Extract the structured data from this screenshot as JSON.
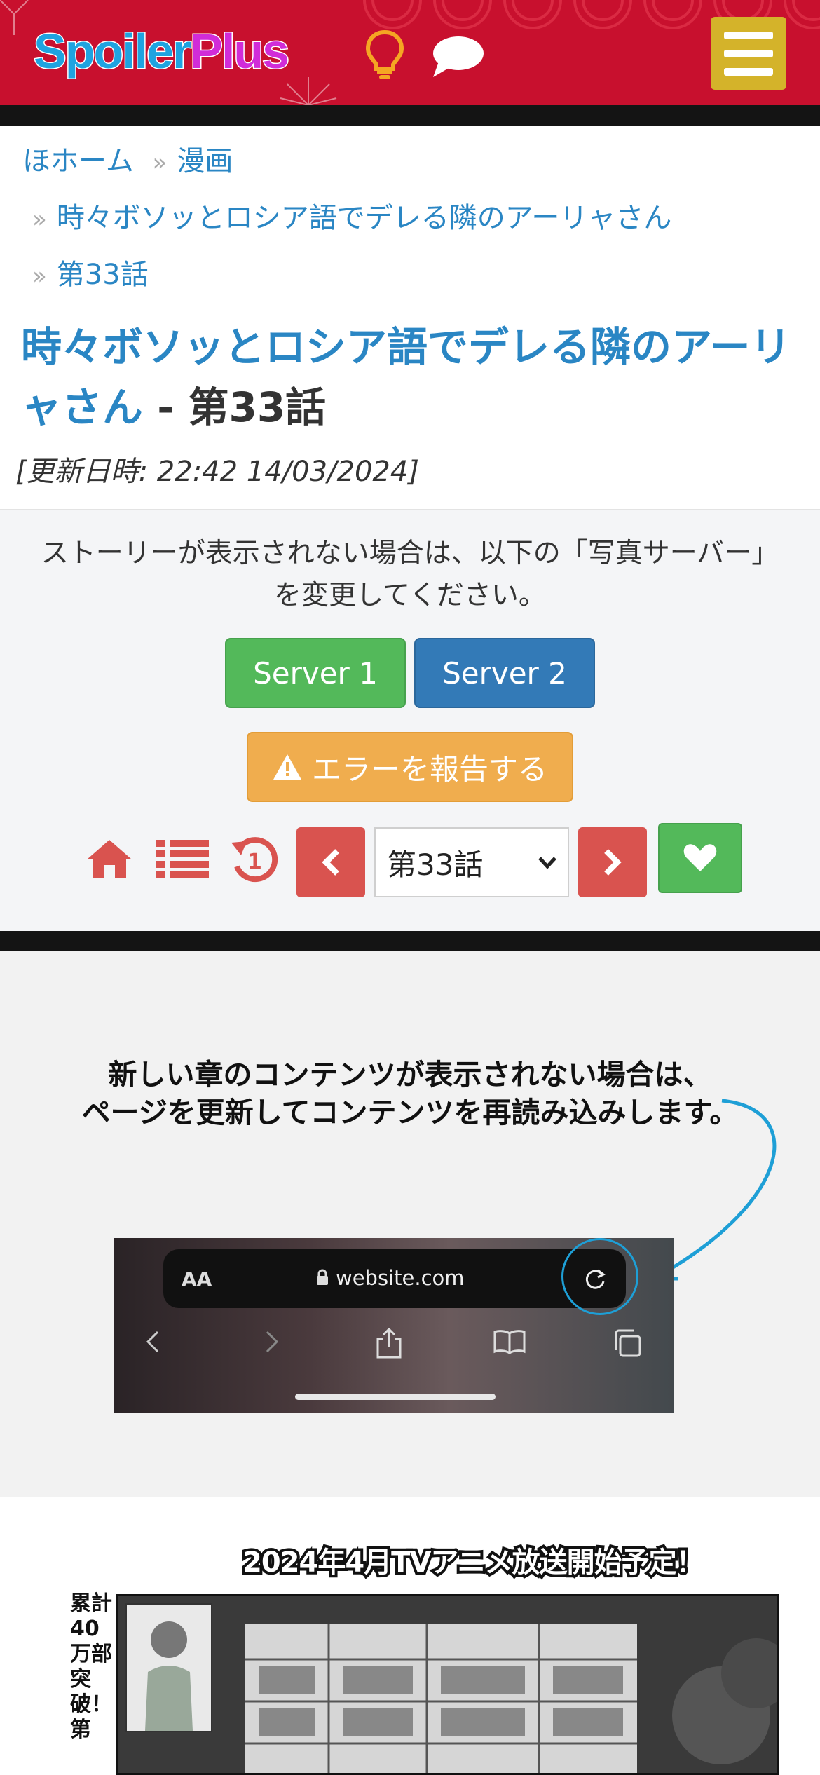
{
  "header": {
    "logo_part1": "Spoiler",
    "logo_part2": "Plus",
    "colors": {
      "background": "#c8102e",
      "logo_blue": "#1fa3e0",
      "logo_pink": "#d12cd8",
      "menu": "#d4b32a",
      "bulb": "#f5a623"
    },
    "icons": [
      "lightbulb-icon",
      "chat-bubble-icon",
      "hamburger-menu-icon"
    ]
  },
  "breadcrumb": {
    "home": "ほホーム",
    "sep": "»",
    "category": "漫画",
    "series": "時々ボソッとロシア語でデレる隣のアーリャさん",
    "chapter": "第33話"
  },
  "page": {
    "title_link": "時々ボソッとロシア語でデレる隣のアーリャさん",
    "title_suffix": " - 第33話",
    "updated": "[更新日時: 22:42 14/03/2024]"
  },
  "panel": {
    "notice": "ストーリーが表示されない場合は、以下の「写真サーバー」を変更してください。",
    "server1": "Server 1",
    "server2": "Server 2",
    "report": "エラーを報告する",
    "chapter_selected": "第33話",
    "colors": {
      "server1": "#53b95a",
      "server2": "#337ab7",
      "report": "#f0ad4e",
      "nav_red": "#d9534f",
      "favorite": "#53b95a"
    },
    "icons": [
      "home-icon",
      "list-icon",
      "history-icon",
      "chevron-left-icon",
      "chevron-right-icon",
      "heart-icon",
      "warning-icon"
    ]
  },
  "hint": {
    "line1": "新しい章のコンテンツが表示されない場合は、",
    "line2": "ページを更新してコンテンツを再読み込みします。",
    "aa": "AA",
    "url": "website.com"
  },
  "manga": {
    "banner": "2024年4月TVアニメ放送開始予定！",
    "side_text": "累計40万部突破！第"
  }
}
